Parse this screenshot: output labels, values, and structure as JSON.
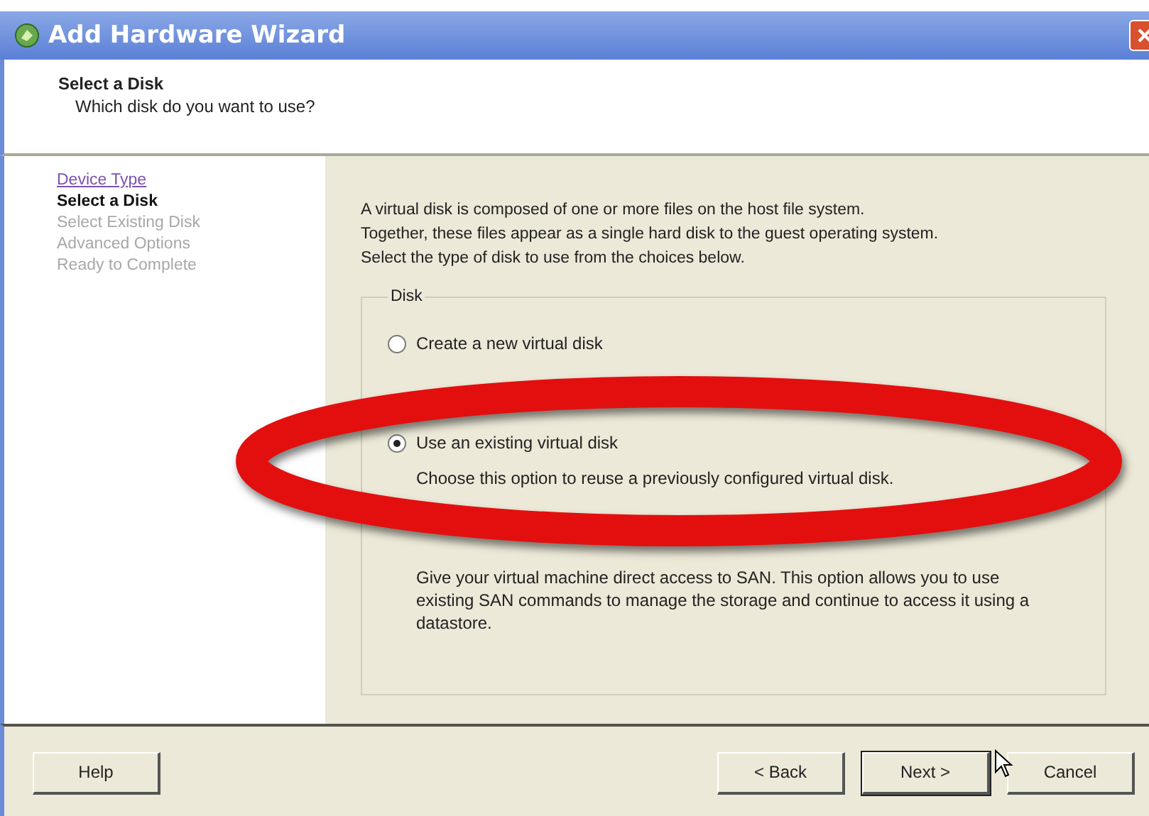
{
  "window": {
    "title": "Add Hardware Wizard"
  },
  "header": {
    "title": "Select a Disk",
    "subtitle": "Which disk do you want to use?"
  },
  "steps": [
    {
      "label": "Device Type",
      "kind": "link"
    },
    {
      "label": "Select a Disk",
      "kind": "current"
    },
    {
      "label": "Select Existing Disk",
      "kind": "pending"
    },
    {
      "label": "Advanced Options",
      "kind": "pending"
    },
    {
      "label": "Ready to Complete",
      "kind": "pending"
    }
  ],
  "intro": [
    "A virtual disk is composed of one or more files on the host file system.",
    "Together, these files appear as a single hard disk to the guest operating system.",
    "Select the type of disk to use from the choices below."
  ],
  "group": {
    "title": "Disk",
    "options": [
      {
        "label": "Create a new virtual disk",
        "selected": false
      },
      {
        "label": "Use an existing virtual disk",
        "description": "Choose this option to reuse a previously configured virtual disk.",
        "selected": true
      },
      {
        "description": "Give your virtual machine direct access to SAN. This option allows you to use existing SAN commands to manage the storage and continue to access it using a datastore."
      }
    ]
  },
  "buttons": {
    "left": [
      "Help"
    ],
    "right": [
      {
        "label": "< Back",
        "focused": false
      },
      {
        "label": "Next >",
        "focused": true
      },
      {
        "label": "Cancel",
        "focused": false
      }
    ]
  }
}
